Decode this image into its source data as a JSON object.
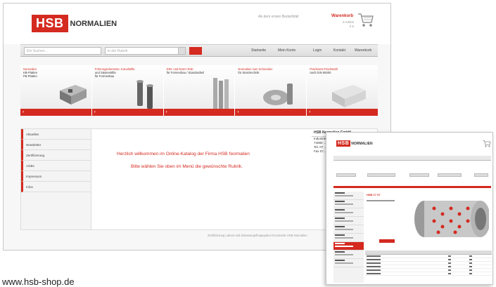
{
  "header": {
    "logo_box": "HSB",
    "logo_text": "NORMALIEN",
    "tagline": "Ab dem ersten Bedarfsfall",
    "cart_label": "Warenkorb",
    "cart_line1": "0 Artikel",
    "cart_line2": "0 €"
  },
  "nav": {
    "search_placeholder": "Ein Suchen...",
    "select_value": "in der Rubrik",
    "items": [
      "Startseite",
      "Mein Konto",
      "Login",
      "Kontakt",
      "Warenkorb"
    ]
  },
  "categories": [
    {
      "title": "Normalien",
      "sub": "KB-Platten\nFB-Platten"
    },
    {
      "title": "Führungselemente, Kanalstifte",
      "sub": "und Säulenstifte\nfür Formenbau"
    },
    {
      "title": "DIN- und Norm-Teile",
      "sub": "für Formenbau / Standardteil"
    },
    {
      "title": "Normalien zum Schneiden",
      "sub": "für Stanztechnik"
    },
    {
      "title": "Präzisions-Flachstahl",
      "sub": "nach DIN 59200"
    }
  ],
  "sidemenu": [
    "Aktuelles",
    "Newsletter",
    "Zertifizierung",
    "AGBs",
    "Impressum",
    "Infos"
  ],
  "welcome": {
    "line1": "Herzlich willkommen im Online-Katalog der Firma HSB Normalien",
    "line2": "Bitte wählen Sie oben im Menü die gewünschte Rubrik."
  },
  "infobox": {
    "title": "HSB Normalien GmbH",
    "lines": [
      "Industriestr.",
      "74080 ...",
      "Tel. 07...",
      "Fax 07..."
    ]
  },
  "footer": "Zertifizierung Labors und Zulassungsfreigegeben Druckzeile HSB Normalien",
  "url": "www.hsb-shop.de",
  "second_screenshot": {
    "logo_box": "HSB",
    "logo_text": "NORMALIEN",
    "product_title": "HSB 17 97"
  },
  "colors": {
    "brand_red": "#d42a20"
  }
}
